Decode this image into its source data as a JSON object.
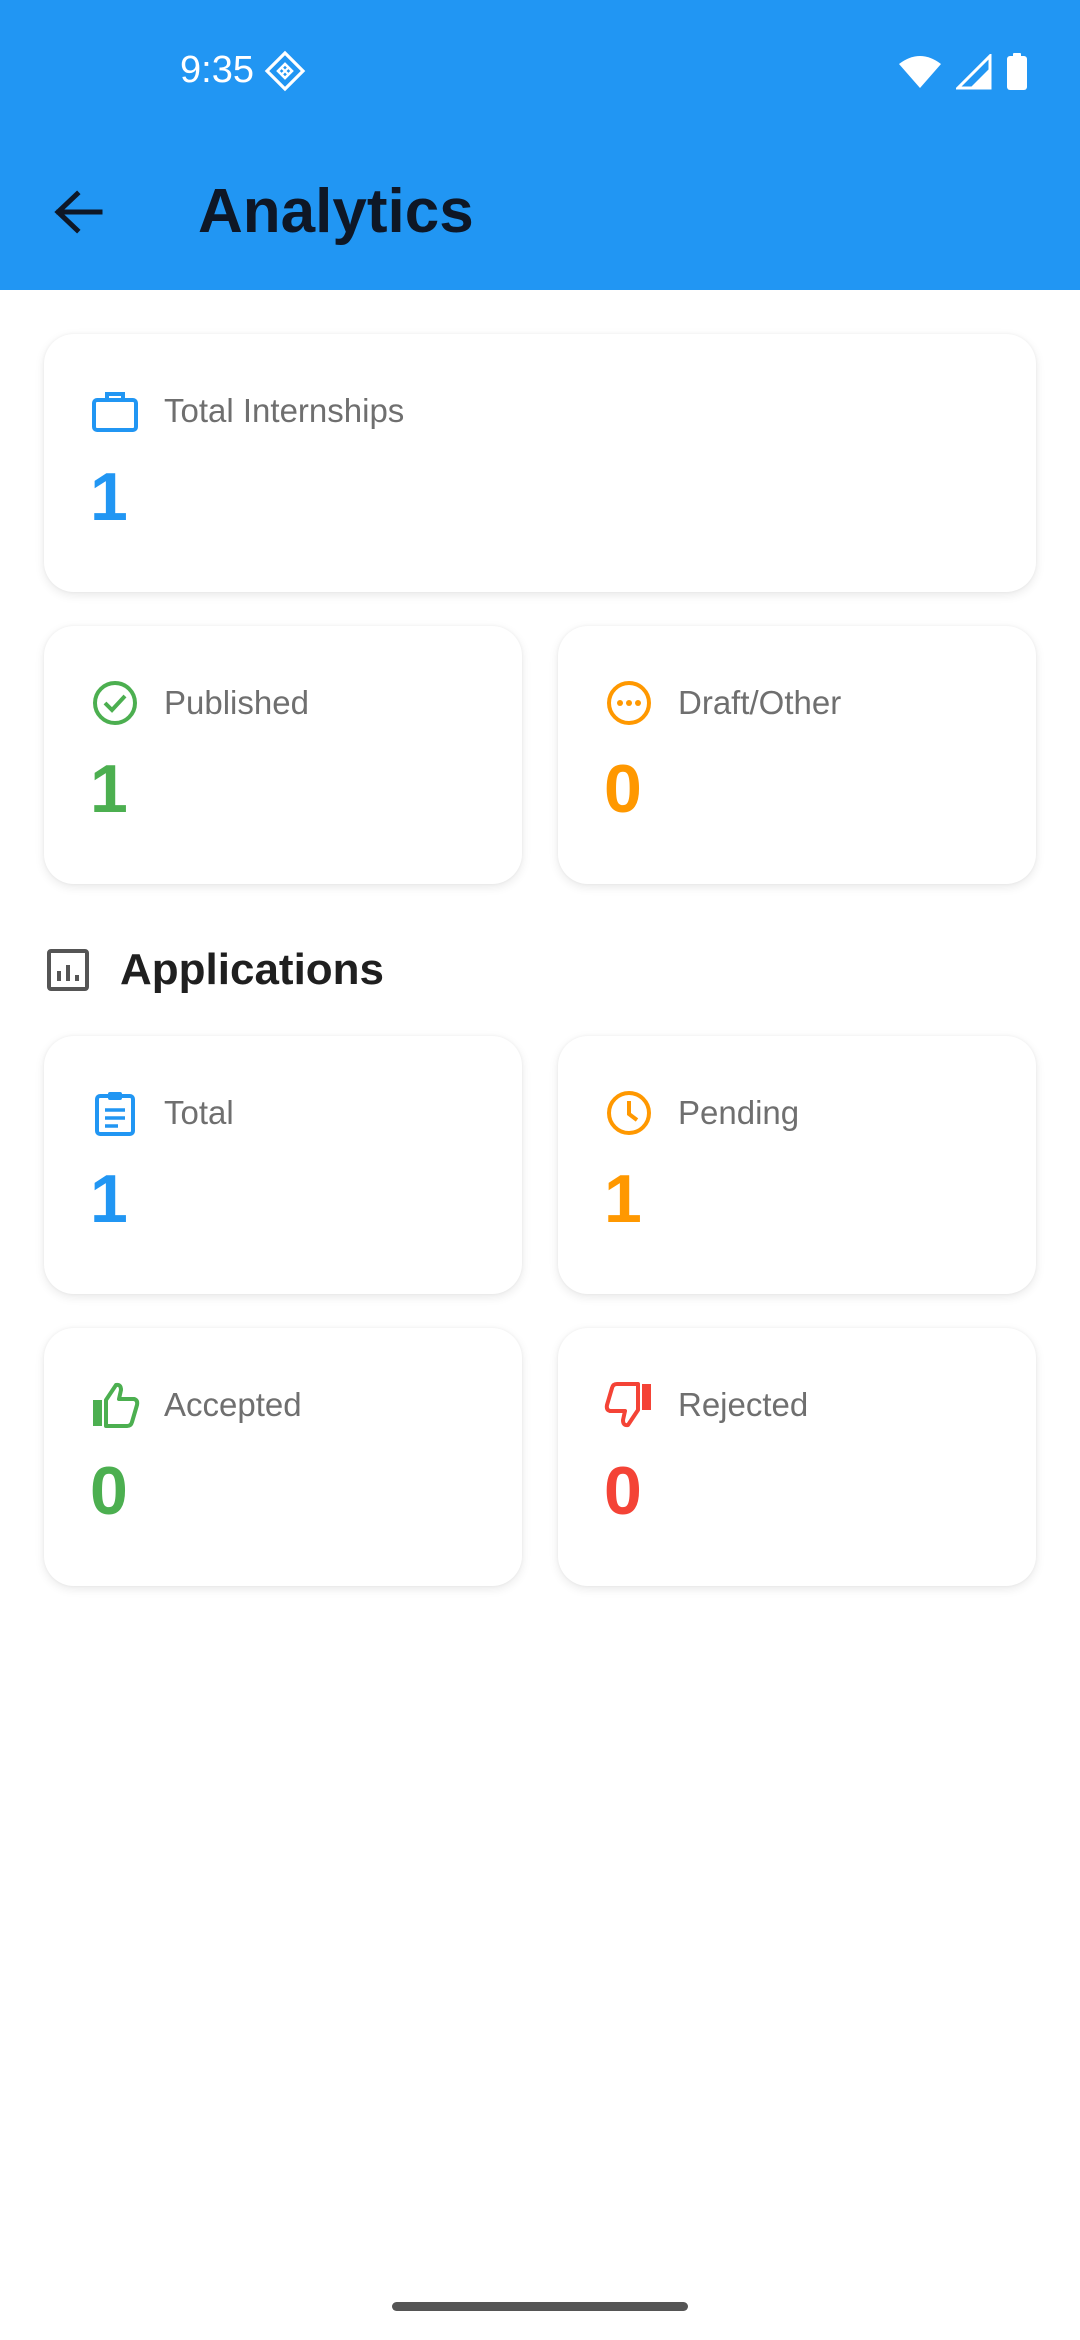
{
  "status_bar": {
    "time": "9:35",
    "icons": [
      "data-saver-icon",
      "wifi-icon",
      "cellular-signal-icon",
      "battery-icon"
    ]
  },
  "app_bar": {
    "title": "Analytics",
    "back_icon": "arrow-back-icon",
    "background": "#2196f3"
  },
  "internships": {
    "total": {
      "label": "Total Internships",
      "value": "1",
      "icon": "briefcase-icon",
      "color": "#2196f3"
    },
    "published": {
      "label": "Published",
      "value": "1",
      "icon": "check-circle-icon",
      "color": "#4caf50"
    },
    "draft": {
      "label": "Draft/Other",
      "value": "0",
      "icon": "more-horiz-circle-icon",
      "color": "#ff9800"
    }
  },
  "applications": {
    "title": "Applications",
    "icon": "analytics-chart-icon",
    "total": {
      "label": "Total",
      "value": "1",
      "icon": "clipboard-icon",
      "color": "#2196f3"
    },
    "pending": {
      "label": "Pending",
      "value": "1",
      "icon": "clock-icon",
      "color": "#ff9800"
    },
    "accepted": {
      "label": "Accepted",
      "value": "0",
      "icon": "thumb-up-icon",
      "color": "#4caf50"
    },
    "rejected": {
      "label": "Rejected",
      "value": "0",
      "icon": "thumb-down-icon",
      "color": "#f44336"
    }
  }
}
